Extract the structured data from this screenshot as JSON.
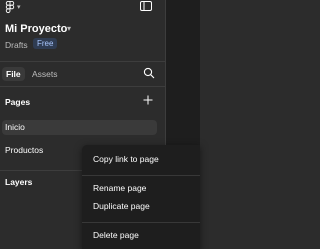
{
  "project": {
    "name": "Mi Proyecto",
    "location": "Drafts",
    "plan_badge": "Free"
  },
  "tabs": [
    {
      "label": "File",
      "active": true
    },
    {
      "label": "Assets",
      "active": false
    }
  ],
  "pages": {
    "title": "Pages",
    "items": [
      {
        "label": "Inicio",
        "selected": true
      },
      {
        "label": "Productos",
        "selected": false
      }
    ]
  },
  "layers": {
    "title": "Layers"
  },
  "context_menu": {
    "copy_link": "Copy link to page",
    "rename": "Rename page",
    "duplicate": "Duplicate page",
    "delete": "Delete page"
  },
  "icons": {
    "app_menu": "figma-logo-icon",
    "layout_toggle": "sidebar-toggle-icon",
    "search": "search-icon",
    "add_page": "plus-icon",
    "project_menu": "chevron-down-icon"
  },
  "colors": {
    "panel_bg": "#2c2c2c",
    "menu_bg": "#1e1e1e",
    "badge_text": "#a9c7ff",
    "badge_bg": "#2f3c52"
  }
}
